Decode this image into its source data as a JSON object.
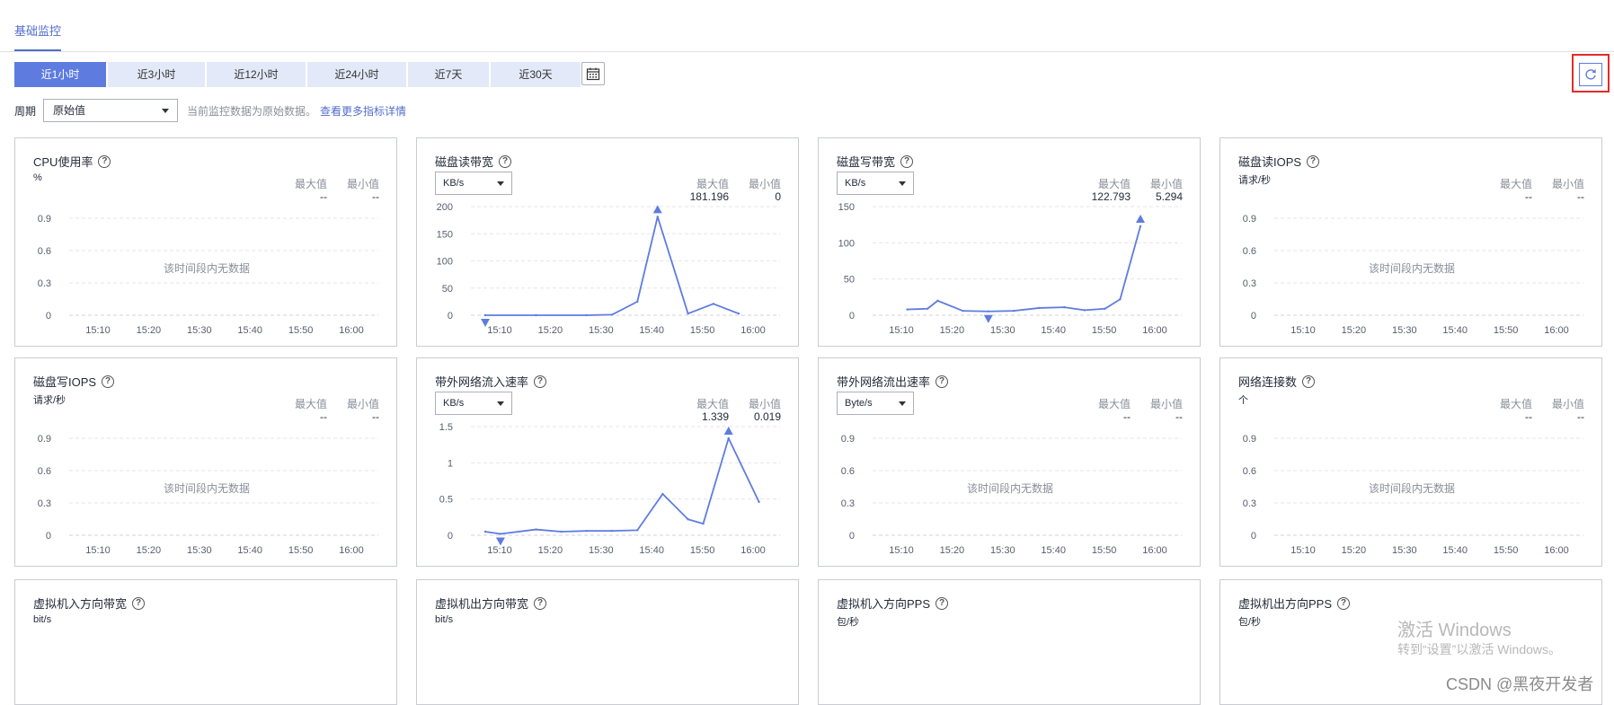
{
  "tabs": {
    "active": "基础监控"
  },
  "time_ranges": [
    "近1小时",
    "近3小时",
    "近12小时",
    "近24小时",
    "近7天",
    "近30天"
  ],
  "active_time_range": "近1小时",
  "period": {
    "label": "周期",
    "value": "原始值",
    "hint": "当前监控数据为原始数据。",
    "link": "查看更多指标详情"
  },
  "stat_labels": {
    "max": "最大值",
    "min": "最小值"
  },
  "no_data_text": "该时间段内无数据",
  "time_ticks": [
    "15:10",
    "15:20",
    "15:30",
    "15:40",
    "15:50",
    "16:00"
  ],
  "icons": {
    "calendar": "calendar-icon",
    "refresh": "refresh-icon",
    "help": "help-icon"
  },
  "accent_color": "#5e7ce0",
  "cards": [
    {
      "title": "CPU使用率",
      "unit": "%",
      "unit_select": null,
      "max": "--",
      "min": "--",
      "has_data": false,
      "chart_data": {
        "type": "line",
        "yticks": [
          "0.9",
          "0.6",
          "0.3",
          "0"
        ],
        "series": []
      }
    },
    {
      "title": "磁盘读带宽",
      "unit": null,
      "unit_select": "KB/s",
      "max": "181.196",
      "min": "0",
      "has_data": true,
      "chart_data": {
        "type": "line",
        "ylim": [
          0,
          200
        ],
        "yticks": [
          "200",
          "150",
          "100",
          "50",
          "0"
        ],
        "x": [
          "15:10",
          "15:20",
          "15:30",
          "15:35",
          "15:40",
          "15:44",
          "15:50",
          "15:55",
          "16:00"
        ],
        "values": [
          0,
          0,
          0,
          1,
          25,
          181.196,
          3,
          21,
          3
        ],
        "max_marker_index": 5,
        "min_marker_index": 0
      }
    },
    {
      "title": "磁盘写带宽",
      "unit": null,
      "unit_select": "KB/s",
      "max": "122.793",
      "min": "5.294",
      "has_data": true,
      "chart_data": {
        "type": "line",
        "ylim": [
          0,
          150
        ],
        "yticks": [
          "150",
          "100",
          "50",
          "0"
        ],
        "x": [
          "15:14",
          "15:18",
          "15:20",
          "15:25",
          "15:30",
          "15:35",
          "15:40",
          "15:45",
          "15:49",
          "15:53",
          "15:56",
          "16:00"
        ],
        "values": [
          8,
          9,
          20,
          6,
          5.294,
          6,
          10,
          11,
          7,
          9,
          22,
          122.793
        ],
        "max_marker_index": 11,
        "min_marker_index": 4
      }
    },
    {
      "title": "磁盘读IOPS",
      "unit": "请求/秒",
      "unit_select": null,
      "max": "--",
      "min": "--",
      "has_data": false,
      "chart_data": {
        "type": "line",
        "yticks": [
          "0.9",
          "0.6",
          "0.3",
          "0"
        ],
        "series": []
      }
    },
    {
      "title": "磁盘写IOPS",
      "unit": "请求/秒",
      "unit_select": null,
      "max": "--",
      "min": "--",
      "has_data": false,
      "chart_data": {
        "type": "line",
        "yticks": [
          "0.9",
          "0.6",
          "0.3",
          "0"
        ],
        "series": []
      }
    },
    {
      "title": "带外网络流入速率",
      "unit": null,
      "unit_select": "KB/s",
      "max": "1.339",
      "min": "0.019",
      "has_data": true,
      "chart_data": {
        "type": "line",
        "ylim": [
          0,
          1.5
        ],
        "yticks": [
          "1.5",
          "1",
          "0.5",
          "0"
        ],
        "x": [
          "15:10",
          "15:13",
          "15:20",
          "15:25",
          "15:30",
          "15:35",
          "15:40",
          "15:45",
          "15:50",
          "15:53",
          "15:58",
          "16:04"
        ],
        "values": [
          0.05,
          0.019,
          0.08,
          0.05,
          0.06,
          0.06,
          0.07,
          0.57,
          0.22,
          0.16,
          1.339,
          0.46
        ],
        "max_marker_index": 10,
        "min_marker_index": 1
      }
    },
    {
      "title": "带外网络流出速率",
      "unit": null,
      "unit_select": "Byte/s",
      "max": "--",
      "min": "--",
      "has_data": false,
      "chart_data": {
        "type": "line",
        "yticks": [
          "0.9",
          "0.6",
          "0.3",
          "0"
        ],
        "series": []
      }
    },
    {
      "title": "网络连接数",
      "unit": "个",
      "unit_select": null,
      "max": "--",
      "min": "--",
      "has_data": false,
      "chart_data": {
        "type": "line",
        "yticks": [
          "0.9",
          "0.6",
          "0.3",
          "0"
        ],
        "series": []
      }
    },
    {
      "title": "虚拟机入方向带宽",
      "unit": "bit/s",
      "unit_select": null,
      "partial": true
    },
    {
      "title": "虚拟机出方向带宽",
      "unit": "bit/s",
      "unit_select": null,
      "partial": true
    },
    {
      "title": "虚拟机入方向PPS",
      "unit": "包/秒",
      "unit_select": null,
      "partial": true
    },
    {
      "title": "虚拟机出方向PPS",
      "unit": "包/秒",
      "unit_select": null,
      "partial": true
    }
  ],
  "watermark": {
    "line1": "激活 Windows",
    "line2": "转到“设置”以激活 Windows。"
  },
  "credit": "CSDN @黑夜开发者"
}
